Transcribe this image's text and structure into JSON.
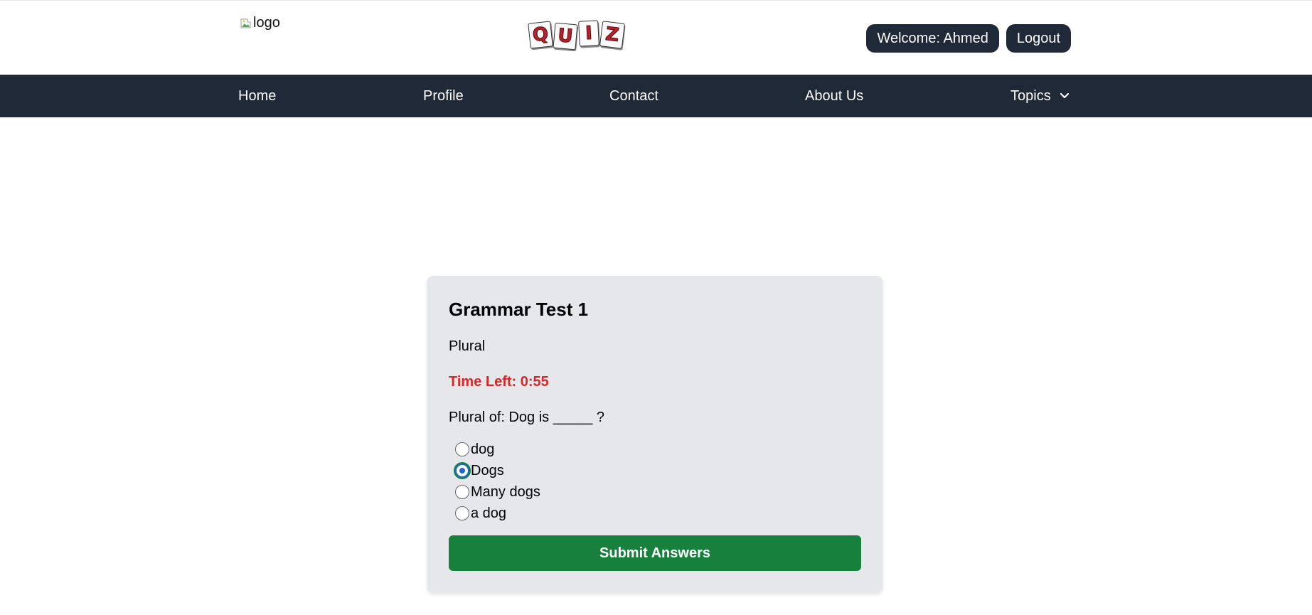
{
  "header": {
    "logo_alt": "logo",
    "brand_tiles": [
      "Q",
      "U",
      "I",
      "Z"
    ],
    "welcome_label": "Welcome: Ahmed",
    "logout_label": "Logout"
  },
  "nav": {
    "items": [
      {
        "label": "Home"
      },
      {
        "label": "Profile"
      },
      {
        "label": "Contact"
      },
      {
        "label": "About Us"
      },
      {
        "label": "Topics",
        "icon": "chevron-down-icon"
      }
    ]
  },
  "quiz": {
    "title": "Grammar Test 1",
    "topic": "Plural",
    "timer": "Time Left: 0:55",
    "question": "Plural of: Dog is _____ ?",
    "options": [
      {
        "label": "dog",
        "selected": false
      },
      {
        "label": "Dogs",
        "selected": true
      },
      {
        "label": "Many dogs",
        "selected": false
      },
      {
        "label": "a dog",
        "selected": false
      }
    ],
    "submit_label": "Submit Answers"
  },
  "colors": {
    "nav_bg": "#1f2937",
    "timer": "#dc2626",
    "submit_bg": "#16803c",
    "card_bg": "#e5e7eb",
    "radio_accent": "#1e66d6"
  }
}
